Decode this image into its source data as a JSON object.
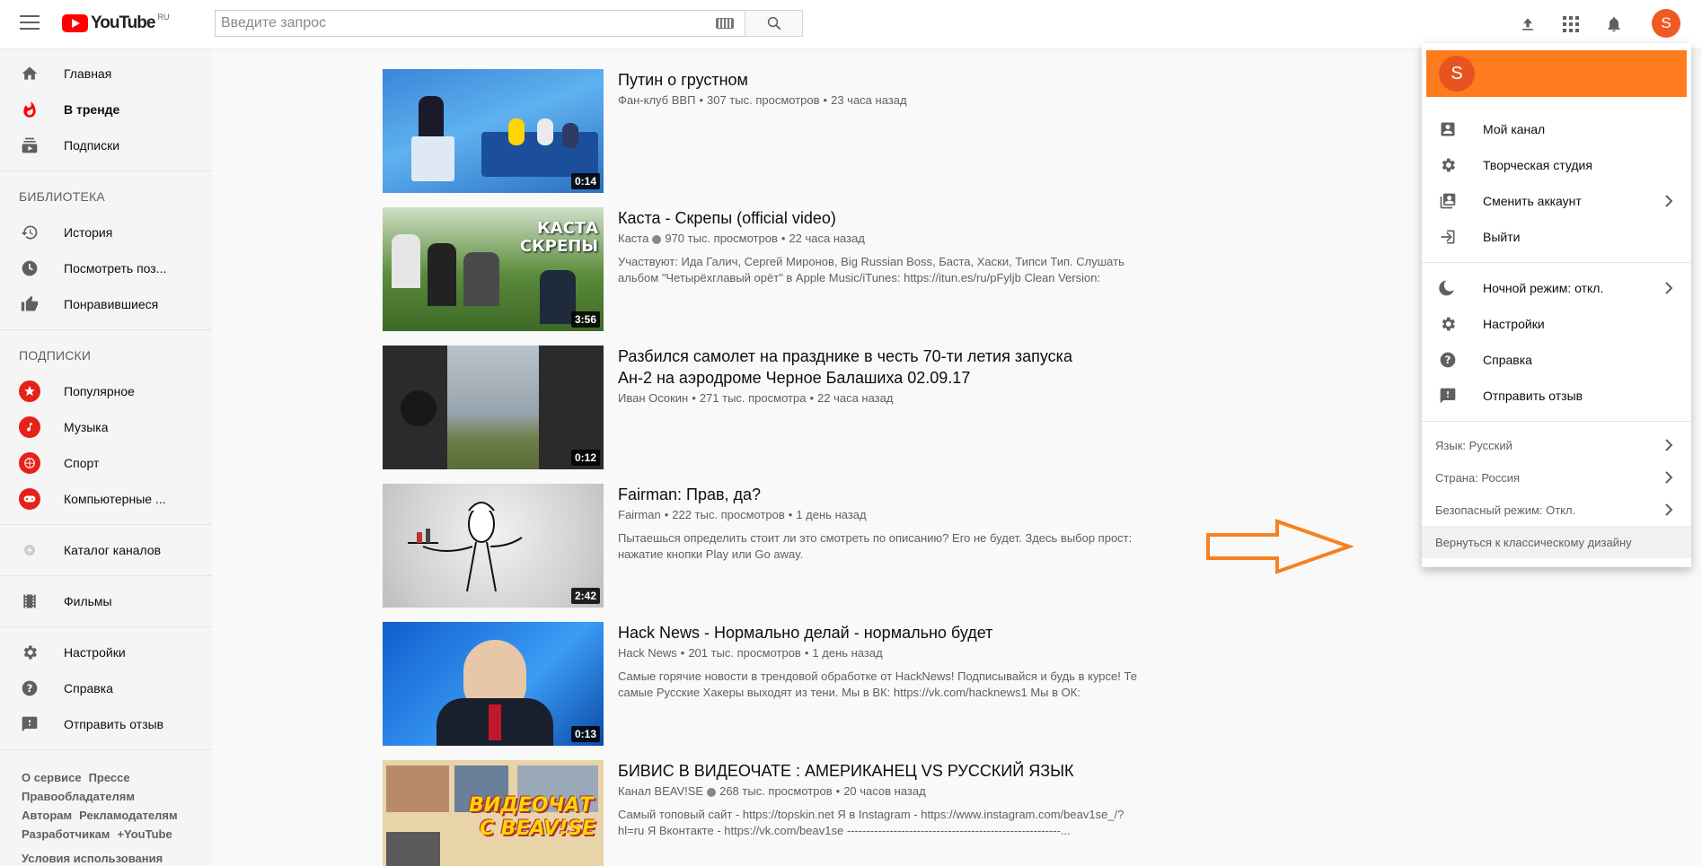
{
  "header": {
    "logo_text": "YouTube",
    "logo_region": "RU",
    "search_placeholder": "Введите запрос",
    "avatar_letter": "S"
  },
  "sidebar": {
    "main": [
      {
        "label": "Главная",
        "icon": "home-icon"
      },
      {
        "label": "В тренде",
        "icon": "trending-icon",
        "active": true
      },
      {
        "label": "Подписки",
        "icon": "subscriptions-icon"
      }
    ],
    "library_heading": "БИБЛИОТЕКА",
    "library": [
      {
        "label": "История",
        "icon": "history-icon"
      },
      {
        "label": "Посмотреть поз...",
        "icon": "clock-icon"
      },
      {
        "label": "Понравившиеся",
        "icon": "thumbs-up-icon"
      }
    ],
    "subs_heading": "ПОДПИСКИ",
    "subscriptions": [
      {
        "label": "Популярное",
        "icon": "star-icon"
      },
      {
        "label": "Музыка",
        "icon": "music-icon"
      },
      {
        "label": "Спорт",
        "icon": "sport-icon"
      },
      {
        "label": "Компьютерные ...",
        "icon": "gamepad-icon"
      }
    ],
    "catalog": "Каталог каналов",
    "movies": "Фильмы",
    "bottom": [
      {
        "label": "Настройки",
        "icon": "gear-icon"
      },
      {
        "label": "Справка",
        "icon": "help-icon"
      },
      {
        "label": "Отправить отзыв",
        "icon": "feedback-icon"
      }
    ],
    "footer": {
      "about": "О сервисе",
      "press": "Прессе",
      "copyright": "Правообладателям",
      "creators": "Авторам",
      "advertisers": "Рекламодателям",
      "developers": "Разработчикам",
      "plus": "+YouTube",
      "terms": "Условия использования"
    }
  },
  "videos": [
    {
      "title": "Путин о грустном",
      "channel": "Фан-клуб ВВП",
      "views": "307 тыс. просмотров",
      "age": "23 часа назад",
      "duration": "0:14",
      "desc1": "",
      "desc2": "",
      "verified": false
    },
    {
      "title": "Каста - Скрепы (official video)",
      "channel": "Каста",
      "views": "970 тыс. просмотров",
      "age": "22 часа назад",
      "duration": "3:56",
      "desc1": "Участвуют: Ида Галич, Сергей Миронов, Big Russian Boss, Баста, Хаски, Типси Тип. Слушать",
      "desc2": "альбом \"Четырёхглавый орёт\" в Apple Music/iTunes: https://itun.es/ru/pFyljb Clean Version:",
      "verified": true,
      "thumb_caption_1": "КАСТА",
      "thumb_caption_2": "СКРЕПЫ"
    },
    {
      "title": "Разбился самолет на празднике в честь 70-ти летия запуска",
      "title2": "Ан-2 на аэродроме Черное Балашиха 02.09.17",
      "channel": "Иван Осокин",
      "views": "271 тыс. просмотра",
      "age": "22 часа назад",
      "duration": "0:12",
      "desc1": "",
      "desc2": "",
      "verified": false
    },
    {
      "title": "Fairman: Прав, да?",
      "channel": "Fairman",
      "views": "222 тыс. просмотров",
      "age": "1 день назад",
      "duration": "2:42",
      "desc1": "Пытаешься определить стоит ли это смотреть по описанию? Его не будет. Здесь выбор прост:",
      "desc2": "нажатие кнопки Play или Go away.",
      "verified": false
    },
    {
      "title": "Hack News - Нормально делай - нормально будет",
      "channel": "Hack News",
      "views": "201 тыс. просмотров",
      "age": "1 день назад",
      "duration": "0:13",
      "desc1": "Самые горячие новости в трендовой обработке от HackNews! Подписывайся и будь в курсе! Те",
      "desc2": "самые Русские Хакеры выходят из тени. Мы в ВК: https://vk.com/hacknews1 Мы в ОК:",
      "verified": false
    },
    {
      "title": "БИВИС В ВИДЕОЧАТЕ : АМЕРИКАНЕЦ VS РУССКИЙ ЯЗЫК",
      "channel": "Канал BEAV!SE",
      "views": "268 тыс. просмотров",
      "age": "20 часов назад",
      "duration": "",
      "desc1": "Самый топовый сайт - https://topskin.net Я в Instagram - https://www.instagram.com/beav1se_/?",
      "desc2": "hl=ru Я Вконтакте - https://vk.com/beav1se -------------------------------------------------------...",
      "verified": true,
      "thumb_caption_1": "ВИДЕОЧАТ",
      "thumb_caption_2": "С BEAV!SE"
    }
  ],
  "account_menu": {
    "avatar_letter": "S",
    "items": [
      {
        "label": "Мой канал",
        "icon": "account-box-icon"
      },
      {
        "label": "Творческая студия",
        "icon": "gear-icon"
      },
      {
        "label": "Сменить аккаунт",
        "icon": "switch-account-icon",
        "chevron": true
      },
      {
        "label": "Выйти",
        "icon": "sign-out-icon"
      }
    ],
    "items2": [
      {
        "label": "Ночной режим: откл.",
        "icon": "moon-icon",
        "chevron": true
      },
      {
        "label": "Настройки",
        "icon": "gear-icon"
      },
      {
        "label": "Справка",
        "icon": "help-icon"
      },
      {
        "label": "Отправить отзыв",
        "icon": "feedback-icon"
      }
    ],
    "language": "Язык: Русский",
    "country": "Страна: Россия",
    "safe_mode": "Безопасный режим: Откл.",
    "classic": "Вернуться к классическому дизайну"
  },
  "colors": {
    "youtube_red": "#ff0000",
    "menu_header": "#ff7b1e",
    "avatar": "#ef5a24",
    "arrow": "#f58220"
  }
}
